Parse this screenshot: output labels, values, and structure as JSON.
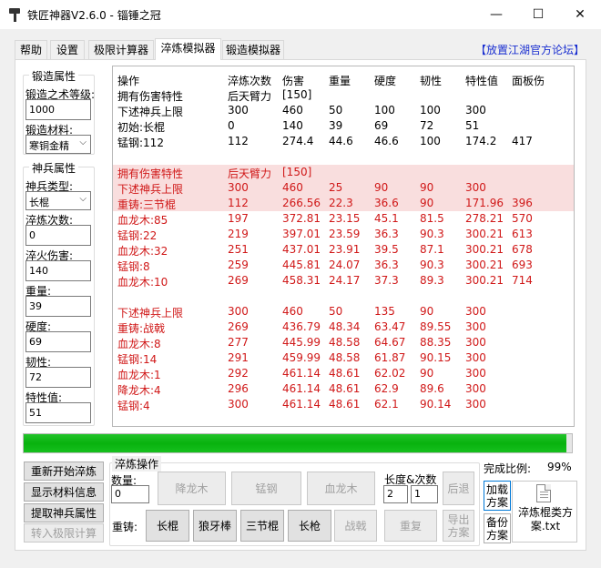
{
  "window": {
    "title": "铁匠神器V2.6.0 - 锱锤之冠",
    "minimize": "—",
    "maximize": "☐",
    "close": "✕"
  },
  "tabs": [
    "帮助",
    "设置",
    "极限计算器",
    "淬炼模拟器",
    "锻造模拟器"
  ],
  "active_tab": "淬炼模拟器",
  "forum_link": "【放置江湖官方论坛】",
  "forging": {
    "title": "锻造属性",
    "level_label": "锻造之术等级:",
    "level_value": "1000",
    "material_label": "锻造材料:",
    "material_value": "寒铜金精"
  },
  "weapon": {
    "title": "神兵属性",
    "type_label": "神兵类型:",
    "type_value": "长棍",
    "quench_count_label": "淬炼次数:",
    "quench_count_value": "0",
    "quench_damage_label": "淬火伤害:",
    "quench_damage_value": "140",
    "weight_label": "重量:",
    "weight_value": "39",
    "hardness_label": "硬度:",
    "hardness_value": "69",
    "toughness_label": "韧性:",
    "toughness_value": "72",
    "trait_label": "特性值:",
    "trait_value": "51"
  },
  "results": {
    "headers": [
      "操作",
      "淬炼次数",
      "伤害",
      "重量",
      "硬度",
      "韧性",
      "特性值",
      "面板伤"
    ],
    "rows": [
      {
        "style": "black",
        "cells": [
          "拥有伤害特性",
          "后天臂力",
          "[150]",
          "",
          "",
          "",
          "",
          ""
        ]
      },
      {
        "style": "black",
        "cells": [
          "下述神兵上限",
          "300",
          "460",
          "50",
          "100",
          "100",
          "300",
          ""
        ]
      },
      {
        "style": "black",
        "cells": [
          "初始:长棍",
          "0",
          "140",
          "39",
          "69",
          "72",
          "51",
          ""
        ]
      },
      {
        "style": "black",
        "cells": [
          "锰钢:112",
          "112",
          "274.4",
          "44.6",
          "46.6",
          "100",
          "174.2",
          "417"
        ]
      },
      {
        "style": "blank",
        "cells": [
          "",
          "",
          "",
          "",
          "",
          "",
          "",
          ""
        ]
      },
      {
        "style": "hl",
        "cells": [
          "拥有伤害特性",
          "后天臂力",
          "[150]",
          "",
          "",
          "",
          "",
          ""
        ]
      },
      {
        "style": "hl",
        "cells": [
          "下述神兵上限",
          "300",
          "460",
          "25",
          "90",
          "90",
          "300",
          ""
        ]
      },
      {
        "style": "hl",
        "cells": [
          "重铸:三节棍",
          "112",
          "266.56",
          "22.3",
          "36.6",
          "90",
          "171.96",
          "396"
        ]
      },
      {
        "style": "red",
        "cells": [
          "血龙木:85",
          "197",
          "372.81",
          "23.15",
          "45.1",
          "81.5",
          "278.21",
          "570"
        ]
      },
      {
        "style": "red",
        "cells": [
          "锰钢:22",
          "219",
          "397.01",
          "23.59",
          "36.3",
          "90.3",
          "300.21",
          "613"
        ]
      },
      {
        "style": "red",
        "cells": [
          "血龙木:32",
          "251",
          "437.01",
          "23.91",
          "39.5",
          "87.1",
          "300.21",
          "678"
        ]
      },
      {
        "style": "red",
        "cells": [
          "锰钢:8",
          "259",
          "445.81",
          "24.07",
          "36.3",
          "90.3",
          "300.21",
          "693"
        ]
      },
      {
        "style": "red",
        "cells": [
          "血龙木:10",
          "269",
          "458.31",
          "24.17",
          "37.3",
          "89.3",
          "300.21",
          "714"
        ]
      },
      {
        "style": "blank",
        "cells": [
          "",
          "",
          "",
          "",
          "",
          "",
          "",
          ""
        ]
      },
      {
        "style": "red",
        "cells": [
          "下述神兵上限",
          "300",
          "460",
          "50",
          "135",
          "90",
          "300",
          ""
        ]
      },
      {
        "style": "red",
        "cells": [
          "重铸:战戟",
          "269",
          "436.79",
          "48.34",
          "63.47",
          "89.55",
          "300",
          ""
        ]
      },
      {
        "style": "red",
        "cells": [
          "血龙木:8",
          "277",
          "445.99",
          "48.58",
          "64.67",
          "88.35",
          "300",
          ""
        ]
      },
      {
        "style": "red",
        "cells": [
          "锰钢:14",
          "291",
          "459.99",
          "48.58",
          "61.87",
          "90.15",
          "300",
          ""
        ]
      },
      {
        "style": "red",
        "cells": [
          "血龙木:1",
          "292",
          "461.14",
          "48.61",
          "62.02",
          "90",
          "300",
          ""
        ]
      },
      {
        "style": "red",
        "cells": [
          "降龙木:4",
          "296",
          "461.14",
          "48.61",
          "62.9",
          "89.6",
          "300",
          ""
        ]
      },
      {
        "style": "red",
        "cells": [
          "锰钢:4",
          "300",
          "461.14",
          "48.61",
          "62.1",
          "90.14",
          "300",
          ""
        ]
      }
    ]
  },
  "progress": {
    "fraction": 0.99
  },
  "left_buttons": {
    "restart": "重新开始淬炼",
    "show_material": "显示材料信息",
    "extract": "提取神兵属性",
    "to_calc": "转入极限计算"
  },
  "quench_ops": {
    "title": "淬炼操作",
    "count_label": "数量:",
    "count_value": "0",
    "mat1": "降龙木",
    "mat2": "锰钢",
    "mat3": "血龙木",
    "len_label": "长度&次数",
    "len_value": "2",
    "times_value": "1",
    "back": "后退",
    "recast_label": "重铸:",
    "recast": [
      "长棍",
      "狼牙棒",
      "三节棍",
      "长枪",
      "战戟"
    ],
    "repeat": "重复",
    "export": "导出方案"
  },
  "ratio_label": "完成比例:",
  "ratio_value": "99%",
  "load_plan": "加载方案",
  "backup_plan": "备份方案",
  "file_name": "淬炼棍类方案.txt",
  "colors": {
    "red_text": "#d01818",
    "highlight": "#f9dede",
    "progress": "#12b81a",
    "link": "#1a2fd0"
  }
}
